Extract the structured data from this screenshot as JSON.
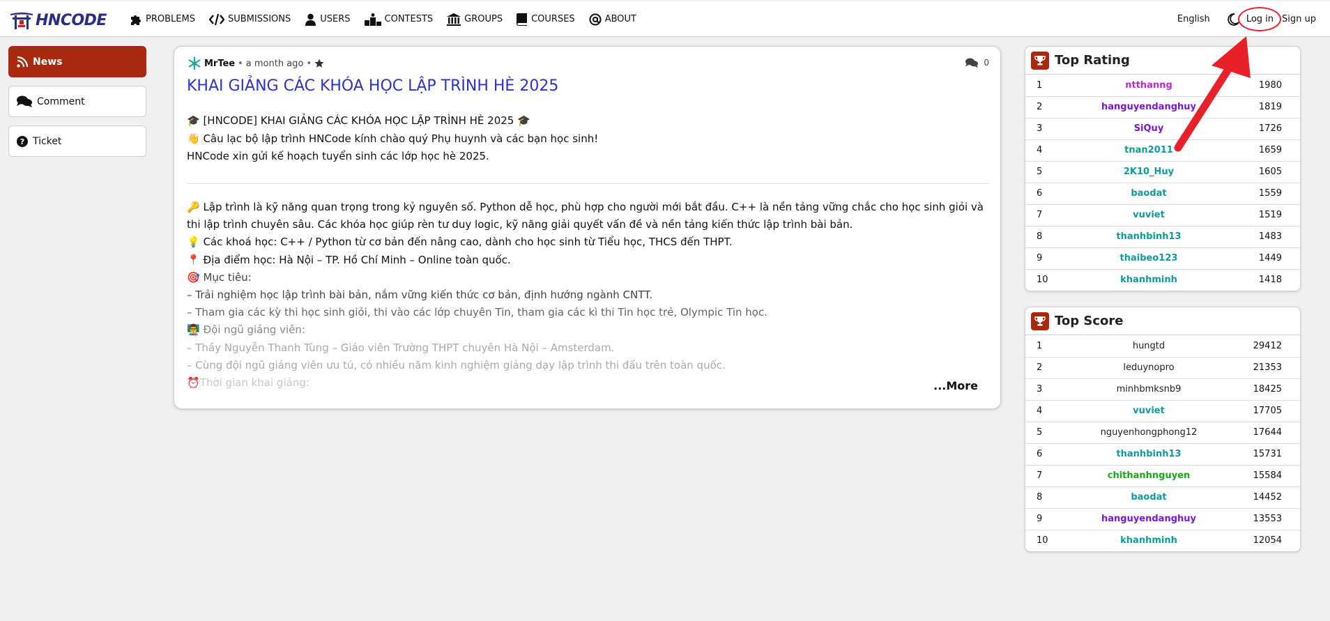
{
  "brand": {
    "name": "HNCODE",
    "logo_icon": "temple-gate-icon"
  },
  "nav": [
    {
      "key": "problems",
      "label": "PROBLEMS",
      "icon": "puzzle-icon"
    },
    {
      "key": "submissions",
      "label": "SUBMISSIONS",
      "icon": "code-icon"
    },
    {
      "key": "users",
      "label": "USERS",
      "icon": "user-icon"
    },
    {
      "key": "contests",
      "label": "CONTESTS",
      "icon": "podium-icon"
    },
    {
      "key": "groups",
      "label": "GROUPS",
      "icon": "building-icon"
    },
    {
      "key": "courses",
      "label": "COURSES",
      "icon": "book-icon"
    },
    {
      "key": "about",
      "label": "ABOUT",
      "icon": "at-icon"
    }
  ],
  "header_right": {
    "language": "English",
    "login": "Log in",
    "signup": "Sign up"
  },
  "sidebar": [
    {
      "label": "News",
      "icon": "rss-icon",
      "active": true
    },
    {
      "label": "Comment",
      "icon": "comments-icon",
      "active": false
    },
    {
      "label": "Ticket",
      "icon": "question-circle-icon",
      "active": false
    }
  ],
  "post": {
    "author": "MrTee",
    "time": "a month ago",
    "comments": "0",
    "title": "KHAI GIẢNG CÁC KHÓA HỌC LẬP TRÌNH HÈ 2025",
    "intro": [
      "🎓 [HNCODE] KHAI GIẢNG CÁC KHÓA HỌC LẬP TRÌNH HÈ 2025 🎓",
      "👋 Câu lạc bộ lập trình HNCode kính chào quý Phụ huynh và các bạn học sinh!",
      "HNCode xin gửi kế hoạch tuyển sinh các lớp học hè 2025."
    ],
    "details": [
      "🔑 Lập trình là kỹ năng quan trọng trong kỷ nguyên số. Python dễ học, phù hợp cho người mới bắt đầu. C++ là nền tảng vững chắc cho học sinh giỏi và thi lập trình chuyên sâu. Các khóa học giúp rèn tư duy logic, kỹ năng giải quyết vấn đề và nền tảng kiến thức lập trình bài bản.",
      "💡 Các khoá học: C++ / Python từ cơ bản đến nâng cao, dành cho học sinh từ Tiểu học, THCS đến THPT.",
      "📍 Địa điểm học: Hà Nội – TP. Hồ Chí Minh – Online toàn quốc.",
      "🎯 Mục tiêu:",
      "– Trải nghiệm học lập trình bài bản, nắm vững kiến thức cơ bản, định hướng ngành CNTT.",
      "– Tham gia các kỳ thi học sinh giỏi, thi vào các lớp chuyên Tin, tham gia các kì thi Tin học trẻ, Olympic Tin học.",
      "👨‍🏫 Đội ngũ giảng viên:",
      "– Thầy Nguyễn Thanh Tùng – Giáo viên Trường THPT chuyên Hà Nội – Amsterdam.",
      "– Cùng đội ngũ giảng viên ưu tú, có nhiều năm kinh nghiệm giảng dạy lập trình thi đấu trên toàn quốc.",
      "⏰Thời gian khai giảng:"
    ],
    "more": "...More"
  },
  "top_rating": {
    "title": "Top Rating",
    "rows": [
      {
        "rank": "1",
        "user": "ntthanng",
        "value": "1980",
        "color": "#c026d3"
      },
      {
        "rank": "2",
        "user": "hanguyendanghuy",
        "value": "1819",
        "color": "#7a17d6"
      },
      {
        "rank": "3",
        "user": "SiQuy",
        "value": "1726",
        "color": "#7a17d6"
      },
      {
        "rank": "4",
        "user": "tnan2011",
        "value": "1659",
        "color": "#0f9b9b"
      },
      {
        "rank": "5",
        "user": "2K10_Huy",
        "value": "1605",
        "color": "#0f9b9b"
      },
      {
        "rank": "6",
        "user": "baodat",
        "value": "1559",
        "color": "#0f9b9b"
      },
      {
        "rank": "7",
        "user": "vuviet",
        "value": "1519",
        "color": "#0f9b9b"
      },
      {
        "rank": "8",
        "user": "thanhbinh13",
        "value": "1483",
        "color": "#0f9b9b"
      },
      {
        "rank": "9",
        "user": "thaibeo123",
        "value": "1449",
        "color": "#0f9b9b"
      },
      {
        "rank": "10",
        "user": "khanhminh",
        "value": "1418",
        "color": "#0f9b9b"
      }
    ]
  },
  "top_score": {
    "title": "Top Score",
    "rows": [
      {
        "rank": "1",
        "user": "hungtd",
        "value": "29412",
        "color": "#222222",
        "plain": true
      },
      {
        "rank": "2",
        "user": "leduynopro",
        "value": "21353",
        "color": "#222222",
        "plain": true
      },
      {
        "rank": "3",
        "user": "minhbmksnb9",
        "value": "18425",
        "color": "#222222",
        "plain": true
      },
      {
        "rank": "4",
        "user": "vuviet",
        "value": "17705",
        "color": "#0f9b9b"
      },
      {
        "rank": "5",
        "user": "nguyenhongphong12",
        "value": "17644",
        "color": "#222222",
        "plain": true
      },
      {
        "rank": "6",
        "user": "thanhbinh13",
        "value": "15731",
        "color": "#0f9b9b"
      },
      {
        "rank": "7",
        "user": "chithanhnguyen",
        "value": "15584",
        "color": "#1aa81a"
      },
      {
        "rank": "8",
        "user": "baodat",
        "value": "14452",
        "color": "#0f9b9b"
      },
      {
        "rank": "9",
        "user": "hanguyendanghuy",
        "value": "13553",
        "color": "#7a17d6"
      },
      {
        "rank": "10",
        "user": "khanhminh",
        "value": "12054",
        "color": "#0f9b9b"
      }
    ]
  },
  "annotation": {
    "color": "#e8202a",
    "icon": "red-arrow-icon"
  }
}
